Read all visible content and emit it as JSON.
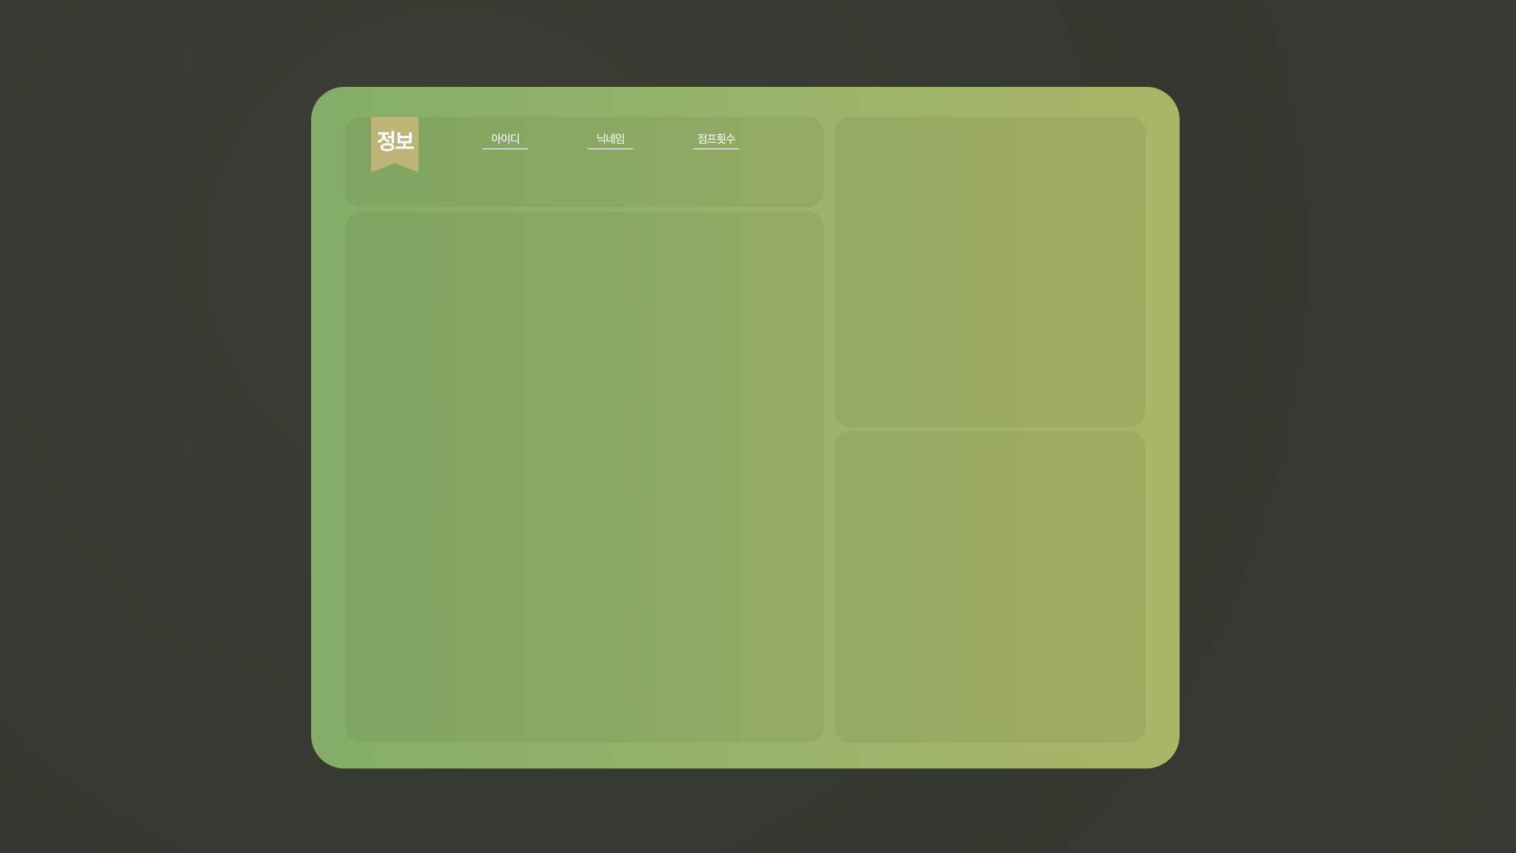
{
  "header": {
    "title": "정보",
    "tabs": [
      {
        "label": "아이디"
      },
      {
        "label": "닉네임"
      },
      {
        "label": "점프횟수"
      }
    ]
  },
  "colors": {
    "background": "#383a33",
    "card_start": "#83ae67",
    "card_end": "#aab568",
    "ribbon": "#bdb478"
  }
}
